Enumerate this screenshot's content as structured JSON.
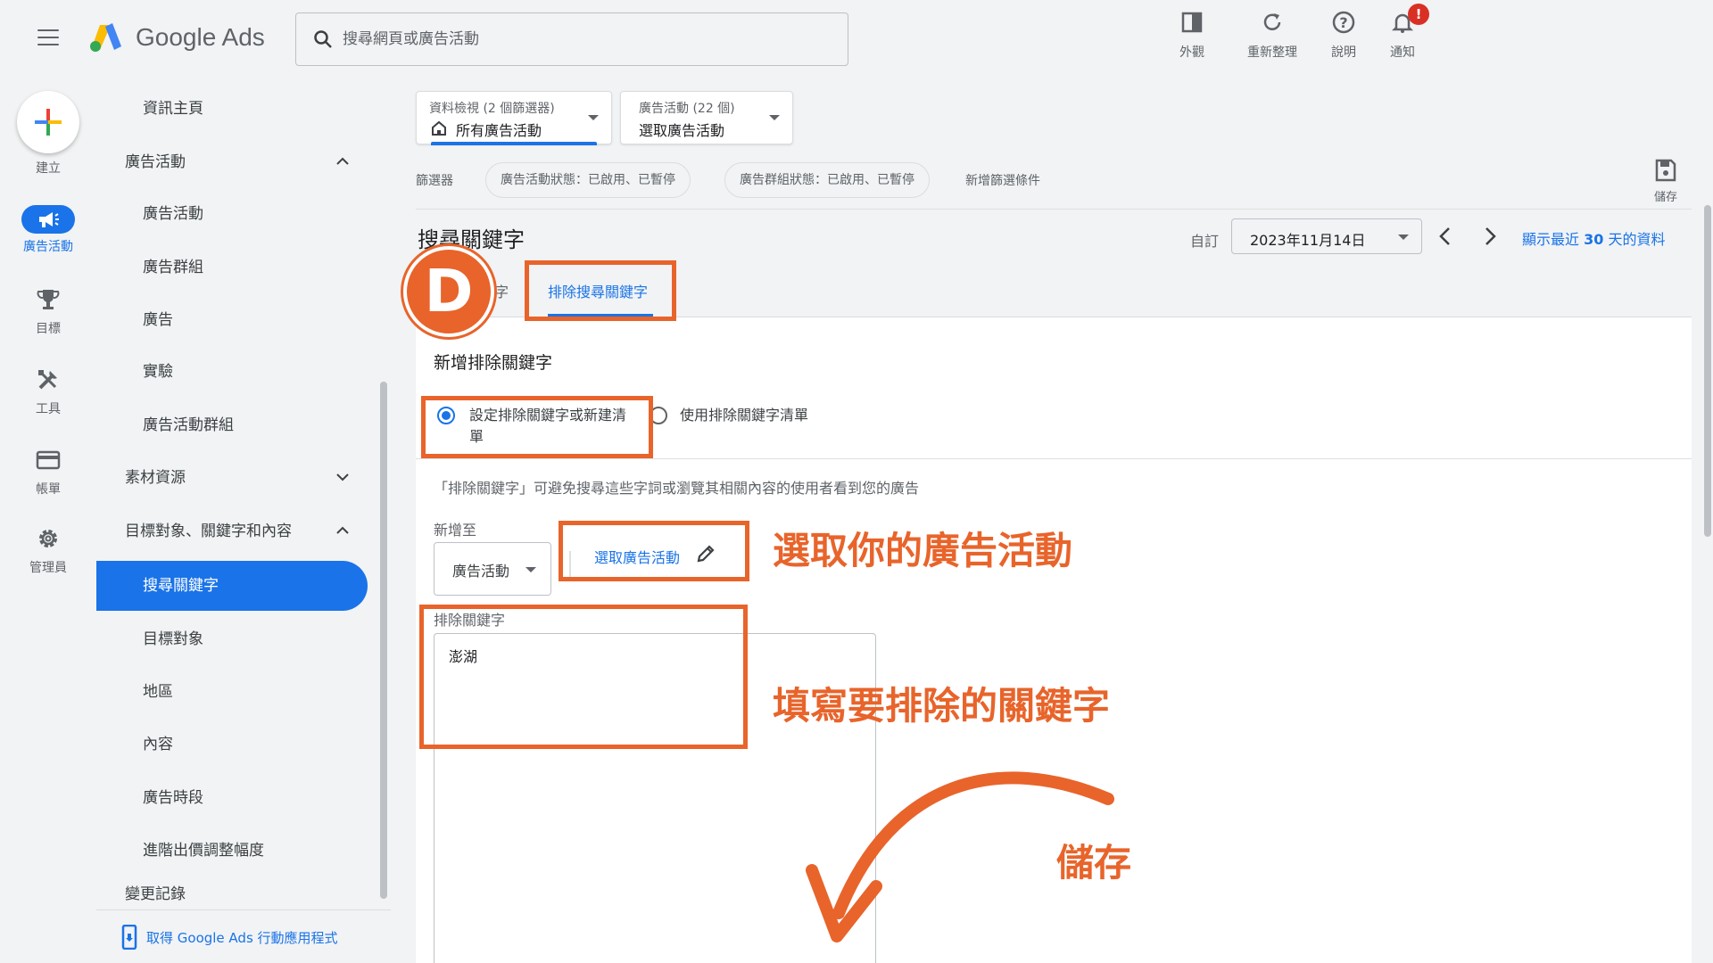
{
  "app": {
    "name": "Google Ads"
  },
  "search": {
    "placeholder": "搜尋網頁或廣告活動"
  },
  "top_actions": [
    {
      "label": "外觀",
      "icon": "appearance-icon"
    },
    {
      "label": "重新整理",
      "icon": "refresh-icon"
    },
    {
      "label": "說明",
      "icon": "help-icon"
    },
    {
      "label": "通知",
      "icon": "bell-icon",
      "badge": "!"
    }
  ],
  "rail": [
    {
      "label": "建立",
      "icon": "plus-icon"
    },
    {
      "label": "廣告活動",
      "icon": "megaphone-icon",
      "active": true
    },
    {
      "label": "目標",
      "icon": "trophy-icon"
    },
    {
      "label": "工具",
      "icon": "tools-icon"
    },
    {
      "label": "帳單",
      "icon": "credit-card-icon"
    },
    {
      "label": "管理員",
      "icon": "gear-icon"
    }
  ],
  "nav": {
    "items": [
      {
        "label": "資訊主頁",
        "kind": "child"
      },
      {
        "label": "廣告活動",
        "kind": "parent",
        "expanded": true
      },
      {
        "label": "廣告活動",
        "kind": "child"
      },
      {
        "label": "廣告群組",
        "kind": "child"
      },
      {
        "label": "廣告",
        "kind": "child"
      },
      {
        "label": "實驗",
        "kind": "child"
      },
      {
        "label": "廣告活動群組",
        "kind": "child"
      },
      {
        "label": "素材資源",
        "kind": "parent",
        "expanded": false
      },
      {
        "label": "目標對象、關鍵字和內容",
        "kind": "parent",
        "expanded": true
      },
      {
        "label": "搜尋關鍵字",
        "kind": "child",
        "active": true
      },
      {
        "label": "目標對象",
        "kind": "child"
      },
      {
        "label": "地區",
        "kind": "child"
      },
      {
        "label": "內容",
        "kind": "child"
      },
      {
        "label": "廣告時段",
        "kind": "child"
      },
      {
        "label": "進階出價調整幅度",
        "kind": "child"
      },
      {
        "label": "變更記錄",
        "kind": "parent"
      }
    ],
    "footer_link": "取得 Google Ads 行動應用程式"
  },
  "view_dd": {
    "small": "資料檢視 (2 個篩選器)",
    "value": "所有廣告活動"
  },
  "campaign_dd": {
    "small": "廣告活動 (22 個)",
    "value": "選取廣告活動"
  },
  "filters": {
    "label": "篩選器",
    "chips": [
      "廣告活動狀態：已啟用、已暫停",
      "廣告群組狀態：已啟用、已暫停"
    ],
    "add": "新增篩選條件",
    "save": "儲存"
  },
  "page": {
    "title": "搜尋關鍵字",
    "custom": "自訂",
    "date": "2023年11月14日",
    "show_recent_prefix": "顯示最近",
    "show_recent_num": "30",
    "show_recent_suffix": "天的資料"
  },
  "tabs": {
    "partial": "字",
    "active": "排除搜尋關鍵字"
  },
  "form": {
    "title": "新增排除關鍵字",
    "radio1_line1": "設定排除關鍵字或新建清",
    "radio1_line2": "單",
    "radio2": "使用排除關鍵字清單",
    "description": "「排除關鍵字」可避免搜尋這些字詞或瀏覽其相關內容的使用者看到您的廣告",
    "add_to_label": "新增至",
    "add_to_value": "廣告活動",
    "select_campaign": "選取廣告活動",
    "keywords_label": "排除關鍵字",
    "keywords_value": "澎湖"
  },
  "annotations": {
    "step": "D",
    "select_campaign": "選取你的廣告活動",
    "fill_keywords": "填寫要排除的關鍵字",
    "save": "儲存",
    "color": "#e8642b"
  }
}
